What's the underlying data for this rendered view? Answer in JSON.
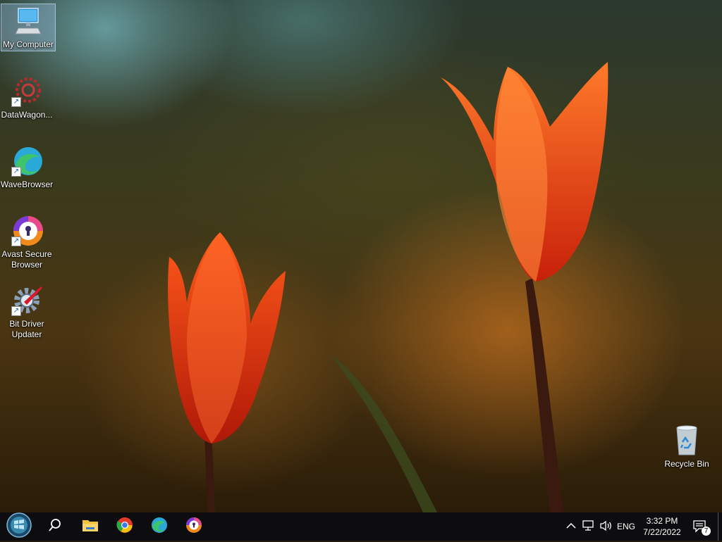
{
  "desktop": {
    "icons": [
      {
        "label": "My Computer",
        "icon": "computer-icon"
      },
      {
        "label": "DataWagon...",
        "icon": "datawagon-icon"
      },
      {
        "label": "WaveBrowser",
        "icon": "wavebrowser-icon"
      },
      {
        "label": "Avast Secure Browser",
        "icon": "avast-secure-browser-icon"
      },
      {
        "label": "Bit Driver Updater",
        "icon": "bit-driver-updater-icon"
      },
      {
        "label": "Recycle Bin",
        "icon": "recycle-bin-icon"
      }
    ]
  },
  "taskbar": {
    "pinned": [
      {
        "name": "start",
        "icon": "start-orb-icon"
      },
      {
        "name": "search",
        "icon": "search-icon"
      },
      {
        "name": "file-explorer",
        "icon": "folder-icon"
      },
      {
        "name": "chrome",
        "icon": "chrome-icon"
      },
      {
        "name": "wavebrowser",
        "icon": "wavebrowser-icon"
      },
      {
        "name": "avast-secure-browser",
        "icon": "avast-secure-browser-icon"
      }
    ],
    "tray": {
      "language": "ENG",
      "time": "3:32 PM",
      "date": "7/22/2022",
      "notification_count": "7"
    }
  },
  "colors": {
    "taskbar": "#0d0d10",
    "selection": "#a0c8f0"
  }
}
